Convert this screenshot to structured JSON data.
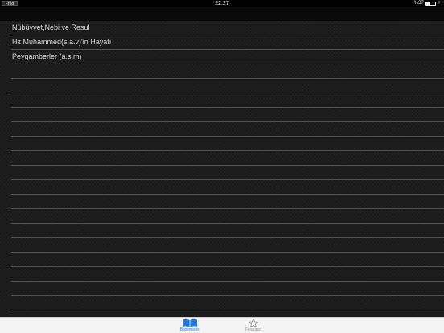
{
  "status_bar": {
    "carrier_badge": "Fred",
    "time": "22:27",
    "battery_text": "%37",
    "battery_level": 0.37,
    "charging_symbol": "⚡"
  },
  "bookmarks": {
    "items": [
      {
        "label": "Nübüvvet,Nebi ve Resul"
      },
      {
        "label": "Hz Muhammed(s.a.v)'in Hayatı"
      },
      {
        "label": "Peygamberler (a.s.m)"
      }
    ]
  },
  "tab_bar": {
    "tabs": [
      {
        "label": "Bookmarks",
        "icon": "open-book-icon",
        "selected": true
      },
      {
        "label": "Featured",
        "icon": "star-outline-icon",
        "selected": false
      }
    ]
  },
  "colors": {
    "accent": "#1a7be8",
    "rule_line": "#b3262e",
    "row_text": "#d8d8d8",
    "inactive_tab": "#8e8e8e"
  }
}
